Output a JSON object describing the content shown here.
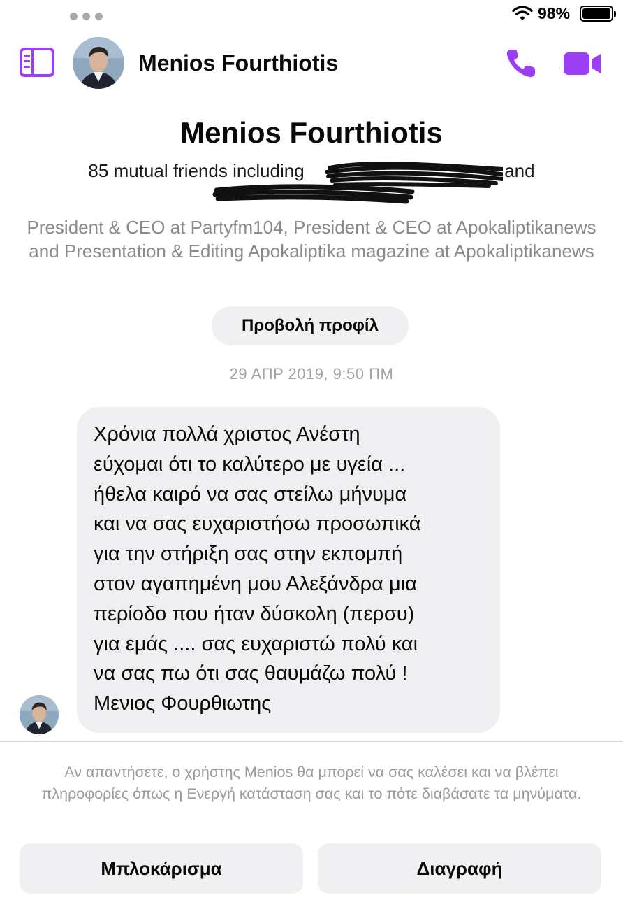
{
  "status_bar": {
    "battery_percent": "98%",
    "battery_level": 0.98
  },
  "header": {
    "contact_name": "Menios Fourthiotis"
  },
  "intro": {
    "name": "Menios Fourthiotis",
    "mutual_friends_line1": "85 mutual friends including",
    "mutual_friends_and": "and",
    "job": "President & CEO at Partyfm104, President & CEO at Apokaliptikanews and Presentation & Editing Apokaliptika magazine at Apokaliptikanews",
    "view_profile_label": "Προβολή προφίλ"
  },
  "conversation": {
    "timestamp": "29 ΑΠΡ 2019, 9:50 ΠΜ",
    "message": "Χρόνια πολλά χριστος Ανέστη\nεύχομαι ότι το καλύτερο με υγεία ...\nήθελα καιρό να σας στείλω μήνυμα\nκαι να σας ευχαριστήσω προσωπικά\nγια την στήριξη σας στην εκπομπή\nστον αγαπημένη μου Αλεξάνδρα μια\nπερίοδο που ήταν δύσκολη (περσυ)\nγια εμάς .... σας ευχαριστώ πολύ και\nνα σας πω ότι σας θαυμάζω πολύ !\nΜενιος Φουρθιωτης"
  },
  "footer": {
    "notice": "Αν απαντήσετε, ο χρήστης Menios θα μπορεί να σας καλέσει και να βλέπει πληροφορίες όπως η Ενεργή κατάσταση σας και το πότε διαβάσατε τα μηνύματα.",
    "block_label": "Μπλοκάρισμα",
    "delete_label": "Διαγραφή"
  },
  "colors": {
    "accent": "#9b3ff5",
    "bubble": "#efeff1",
    "secondary_text": "#8a8a8e"
  },
  "icons": [
    "sidebar-icon",
    "phone-icon",
    "video-camera-icon",
    "wifi-icon",
    "battery-icon"
  ]
}
